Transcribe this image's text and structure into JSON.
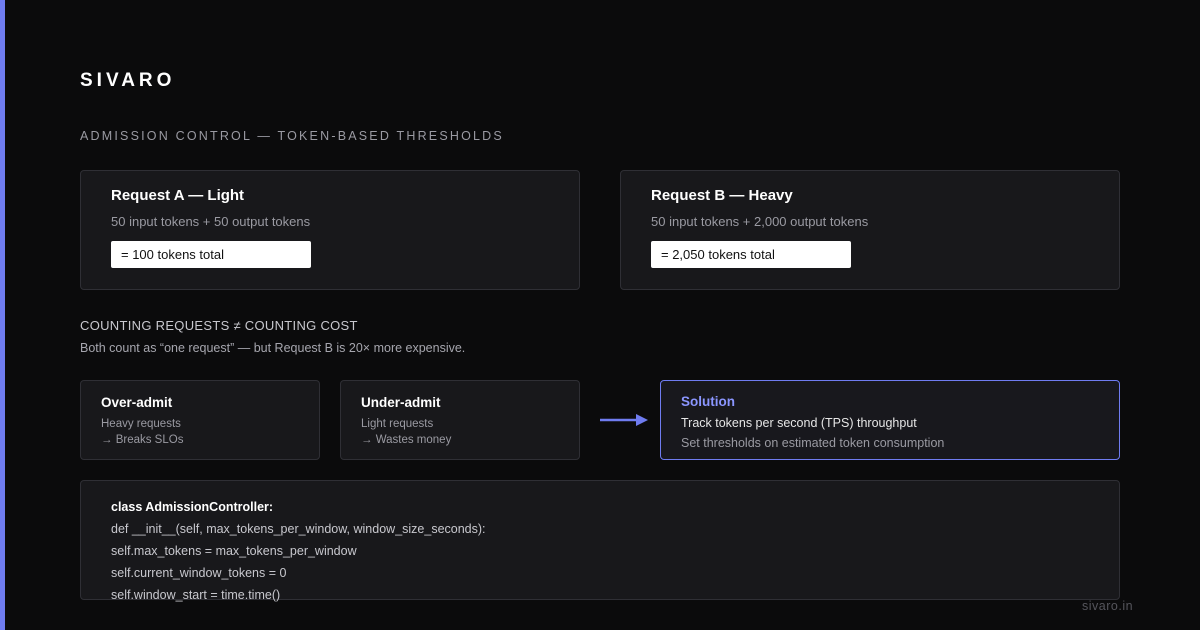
{
  "brand": "SIVARO",
  "section_title": "ADMISSION CONTROL — TOKEN-BASED THRESHOLDS",
  "request_a": {
    "title": "Request A — Light",
    "detail": "50 input tokens + 50 output tokens",
    "total": "= 100 tokens total"
  },
  "request_b": {
    "title": "Request B — Heavy",
    "detail": "50 input tokens + 2,000 output tokens",
    "total": "= 2,050 tokens total"
  },
  "counting": {
    "title": "COUNTING REQUESTS ≠ COUNTING COST",
    "subtitle": "Both count as “one request” — but Request B is 20× more expensive."
  },
  "over_admit": {
    "title": "Over-admit",
    "line1": "Heavy requests",
    "line2": "→ Breaks SLOs"
  },
  "under_admit": {
    "title": "Under-admit",
    "line1": "Light requests",
    "line2": "→ Wastes money"
  },
  "solution": {
    "title": "Solution",
    "line1": "Track tokens per second (TPS) throughput",
    "line2": "Set thresholds on estimated token consumption"
  },
  "code": {
    "lines": [
      "class AdmissionController:",
      "def __init__(self, max_tokens_per_window, window_size_seconds):",
      "self.max_tokens = max_tokens_per_window",
      "self.current_window_tokens = 0",
      "self.window_start = time.time()"
    ]
  },
  "footer": "sivaro.in",
  "colors": {
    "background": "#0b0b0c",
    "accent": "#6f7cf0",
    "solution_title": "#8b96ff",
    "card": "#18181b"
  },
  "icons": [
    "arrow-right-icon"
  ]
}
